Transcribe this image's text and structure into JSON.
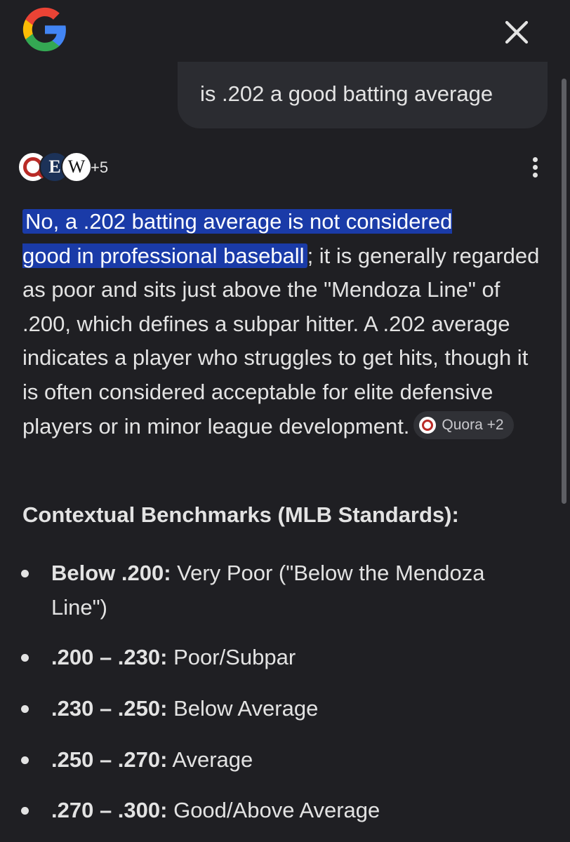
{
  "header": {
    "logo_icon": "google-g-logo",
    "close_icon": "close-x-icon"
  },
  "query": {
    "text": "is .202 a good batting average"
  },
  "sources": {
    "icons": [
      "quora-icon",
      "ew-icon",
      "wikipedia-icon"
    ],
    "ew_letter": "E",
    "w_letter": "W",
    "more_label": "+5",
    "menu_icon": "more-vert-icon"
  },
  "answer": {
    "highlight_line1": "No, a .202 batting average is not considered",
    "highlight_line2": "good in professional baseball",
    "body": "; it is generally regarded as poor and sits just above the \"Mendoza Line\" of .200, which defines a subpar hitter. A .202 average indicates a player who struggles to get hits, though it is often considered acceptable for elite defensive players or in minor league development.",
    "citation_chip": "Quora +2",
    "highlight_color": "#1a3ba8"
  },
  "section": {
    "heading": "Contextual Benchmarks (MLB Standards):"
  },
  "benchmarks": [
    {
      "range": "Below .200:",
      "label": " Very Poor (\"Below the Mendoza Line\")"
    },
    {
      "range": ".200 – .230:",
      "label": " Poor/Subpar"
    },
    {
      "range": ".230 – .250:",
      "label": " Below Average"
    },
    {
      "range": ".250 – .270:",
      "label": " Average"
    },
    {
      "range": ".270 – .300:",
      "label": " Good/Above Average"
    }
  ],
  "colors": {
    "background": "#1f1f23",
    "query_bubble": "#2b2c31",
    "text": "#e3e3e3"
  }
}
